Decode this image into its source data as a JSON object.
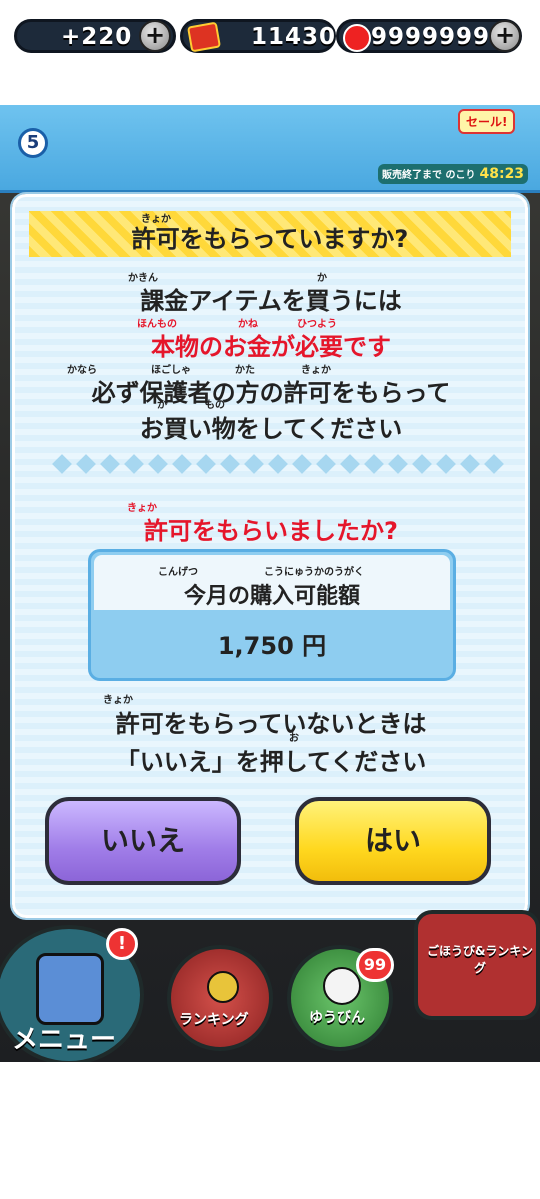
{
  "hud": {
    "stamina_level": "5",
    "stamina_value": "+220",
    "coin_value": "11430",
    "money_value": "9999999",
    "sale_tag": "セール!",
    "timer_label": "販売終了まで のこり",
    "timer_value": "48:23",
    "plus_label": "+"
  },
  "dialog": {
    "title": "許可をもらっていますか?",
    "title_ruby": "きょか",
    "line1": "課金アイテムを買うには",
    "line1_ruby_a": "かきん",
    "line1_ruby_b": "か",
    "line2": "本物のお金が必要です",
    "line2_ruby_a": "ほんもの",
    "line2_ruby_b": "かね",
    "line2_ruby_c": "ひつよう",
    "line3": "必ず保護者の方の許可をもらって",
    "line3_ruby_a": "かなら",
    "line3_ruby_b": "ほごしゃ",
    "line3_ruby_c": "かた",
    "line3_ruby_d": "きょか",
    "line4": "お買い物をしてください",
    "line4_ruby_a": "か",
    "line4_ruby_b": "もの",
    "question": "許可をもらいましたか?",
    "question_ruby": "きょか",
    "limit_label": "今月の購入可能額",
    "limit_ruby_a": "こんげつ",
    "limit_ruby_b": "こうにゅうかのうがく",
    "limit_amount": "1,750 円",
    "note1": "許可をもらっていないときは",
    "note1_ruby": "きょか",
    "note2": "「いいえ」を押してください",
    "note2_ruby": "お",
    "no_button": "いいえ",
    "yes_button": "はい"
  },
  "bottom_menu": {
    "menu_label": "メニュー",
    "menu_badge": "!",
    "ranking_label": "ランキング",
    "mail_label": "ゆうびん",
    "mail_count": "99",
    "reward_label": "ごほうび&ランキング"
  },
  "colors": {
    "accent_red": "#e5162b",
    "no_button": "#a07de8",
    "yes_button": "#ffd81f",
    "hud_blue": "#4aa8e0"
  }
}
